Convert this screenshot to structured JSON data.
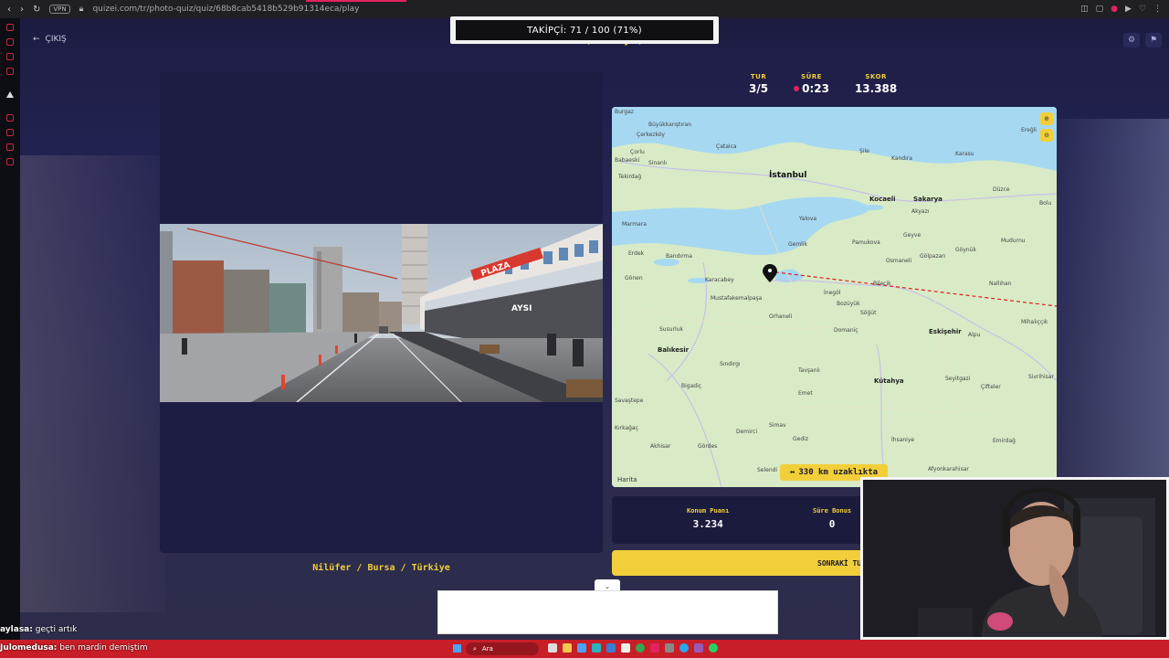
{
  "browser": {
    "vpn_label": "VPN",
    "url": "quizei.com/tr/photo-quiz/quiz/68b8cab5418b529b91314eca/play"
  },
  "header": {
    "exit_label": "ÇIKIŞ",
    "follower_banner": "TAKİPÇİ: 71 / 100 (71%)",
    "subtitle_fragment": "Location (Türkiye)"
  },
  "stats": {
    "round_label": "TUR",
    "round_value": "3/5",
    "time_label": "SÜRE",
    "time_value": "0:23",
    "score_label": "SKOR",
    "score_value": "13.388"
  },
  "photo": {
    "plaza_sign": "PLAZA",
    "store_sign": "AYSI",
    "location": "Nilüfer / Bursa / Türkiye"
  },
  "map": {
    "big_cities": [
      "İstanbul"
    ],
    "cities": [
      "Kocaeli",
      "Sakarya",
      "Eskişehir",
      "Balıkesir",
      "Kütahya",
      "Bandırma",
      "Karacabey",
      "Mustafakemalpaşa",
      "Tekirdağ",
      "Çorlu",
      "Gemlik",
      "Yalova",
      "Bilecik",
      "İnegöl",
      "Bolu",
      "Ereğli",
      "Düzce",
      "Afyonkarahisar",
      "Akhisar",
      "Gördes",
      "Simav",
      "Gediz",
      "Tavşanlı",
      "Emet",
      "Bigadiç",
      "Sındırgı",
      "Susurluk",
      "Orhaneli",
      "Domaniç",
      "Söğüt",
      "Bozüyük",
      "Nallıhan",
      "Mihalıççık",
      "Sivrihisar",
      "Seyitgazi",
      "Çifteler",
      "Emirdağ",
      "İhsaniye",
      "Gönen",
      "Erdek",
      "Marmara",
      "Çerkezköy",
      "Çatalca",
      "Şile",
      "Kandıra",
      "Karasu",
      "Akyazı",
      "Geyve",
      "Pamukova",
      "Osmaneli",
      "Gölpazarı",
      "Göynük",
      "Mudurnu",
      "Alpu",
      "Demirci",
      "Selendi",
      "Savaştepe",
      "Kırkağaç",
      "Burgaz",
      "Büyükkarıştıran",
      "Sinanlı",
      "Babaeski"
    ],
    "attribution": "Harita",
    "distance": "330 km uzaklıkta"
  },
  "score_panel": {
    "location_points_label": "Konum Puanı",
    "location_points_value": "3.234",
    "time_bonus_label": "Süre Bonus",
    "time_bonus_value": "0",
    "next_button": "SONRAKİ TUR"
  },
  "chat": [
    {
      "user": "aylasa:",
      "message": "geçti artık"
    },
    {
      "user": "Julomedusa:",
      "message": "ben mardin demiştim"
    }
  ],
  "taskbar": {
    "search_label": "Ara"
  },
  "colors": {
    "accent": "#f2cf3a",
    "background": "#14142e",
    "panel": "#1d1d44",
    "taskbar": "#c81e28",
    "guess_line": "#e01e1e"
  }
}
